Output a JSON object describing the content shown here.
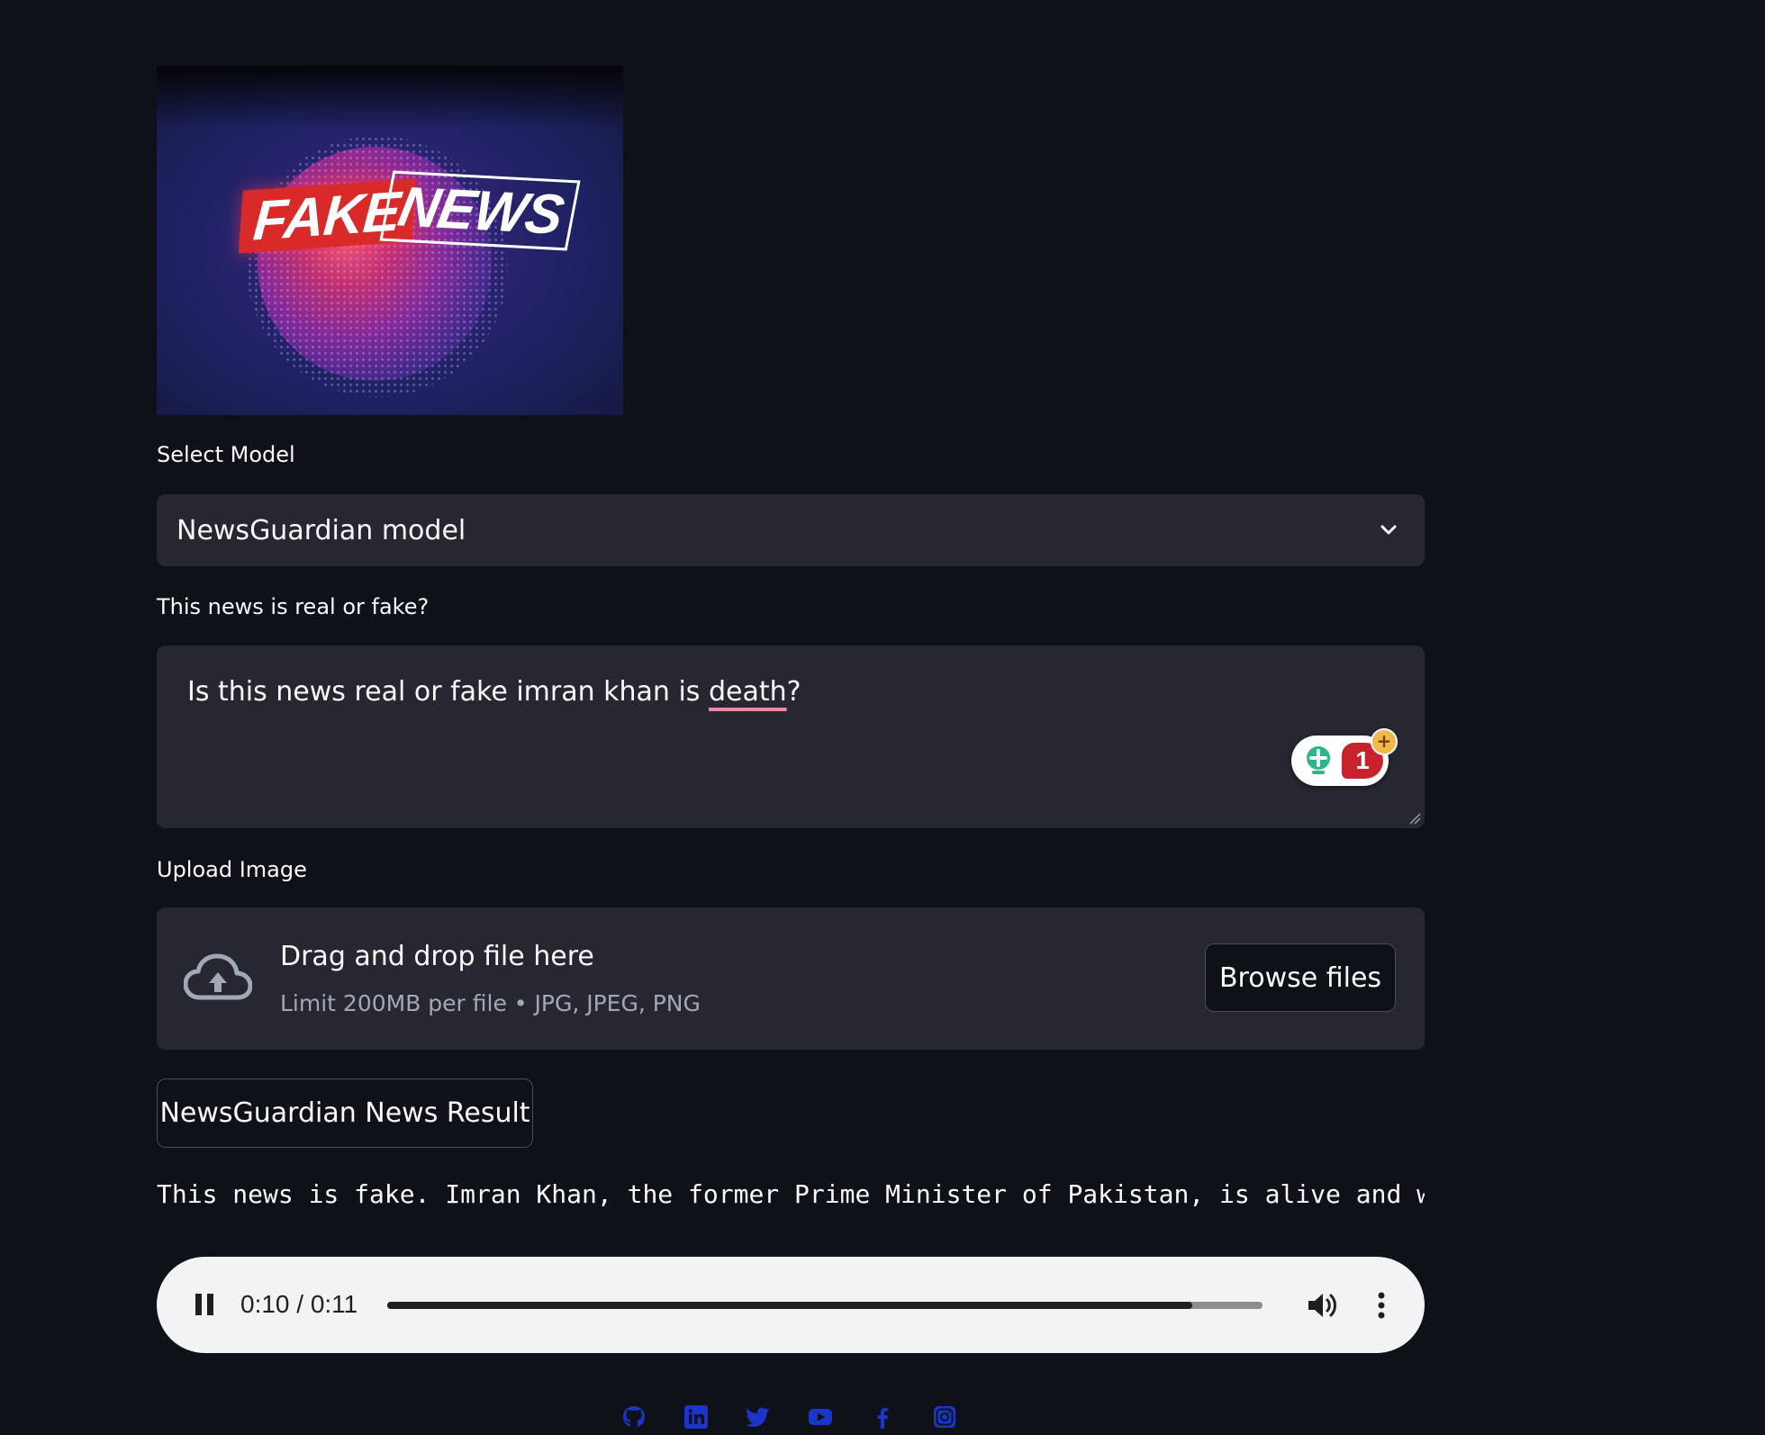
{
  "hero": {
    "logo_word_1": "FAKE",
    "logo_word_2": "NEWS"
  },
  "model_select": {
    "label": "Select Model",
    "selected": "NewsGuardian model"
  },
  "news_input": {
    "label": "This news is real or fake?",
    "value_before": "Is this news real or fake imran khan is ",
    "value_flagged": "death",
    "value_after": "?",
    "grammar_issue_count": "1"
  },
  "upload": {
    "label": "Upload Image",
    "drop_title": "Drag and drop file here",
    "drop_limit": "Limit 200MB per file • JPG, JPEG, PNG",
    "browse_label": "Browse files"
  },
  "result_button": {
    "label": "NewsGuardian News Result"
  },
  "result": {
    "text": "This news is fake. Imran Khan, the former Prime Minister of Pakistan, is alive and w"
  },
  "audio": {
    "time": "0:10 / 0:11",
    "progress_fraction": 0.92
  },
  "socials": [
    "github-icon",
    "linkedin-icon",
    "twitter-icon",
    "youtube-icon",
    "facebook-icon",
    "instagram-icon"
  ],
  "colors": {
    "background": "#0e1117",
    "surface": "#262730",
    "text": "#fafafa",
    "muted": "#a3a8b8",
    "social_blue": "#1a35c7"
  }
}
